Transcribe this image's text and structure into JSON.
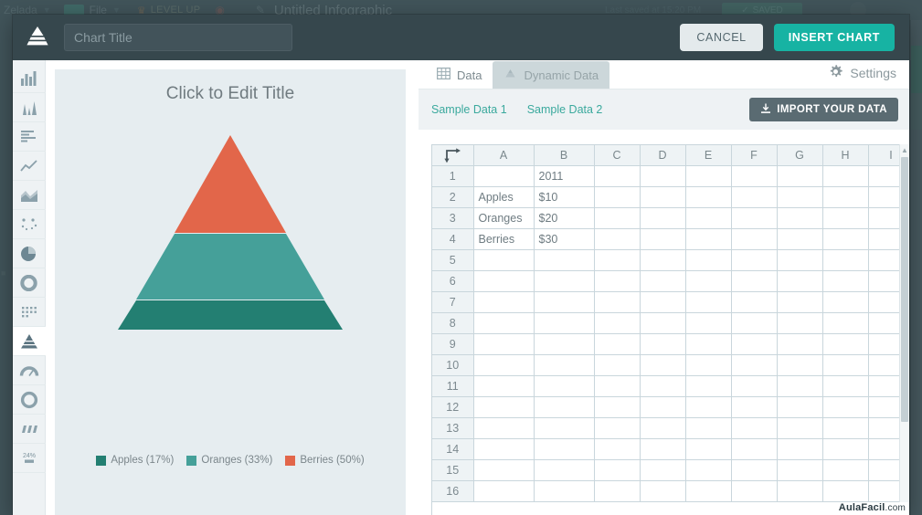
{
  "background": {
    "user": "Zelada",
    "file_menu": "File",
    "level_up": "LEVEL UP",
    "document_title": "Untitled Infographic",
    "last_saved": "Last saved at 15:20 PM",
    "saved_badge": "SAVED"
  },
  "header": {
    "logo": "pyramid-logo",
    "title_value": "",
    "title_placeholder": "Chart Title",
    "cancel_label": "CANCEL",
    "insert_label": "INSERT CHART"
  },
  "chart_types": [
    {
      "name": "bar-chart",
      "label": "Bar Chart",
      "active": false
    },
    {
      "name": "column-chart",
      "label": "Column Chart",
      "active": false
    },
    {
      "name": "horizontal-bar-chart",
      "label": "Horizontal Bar Chart",
      "active": false
    },
    {
      "name": "line-chart",
      "label": "Line Chart",
      "active": false
    },
    {
      "name": "area-chart",
      "label": "Area Chart",
      "active": false
    },
    {
      "name": "scatter-chart",
      "label": "Scatter Chart",
      "active": false
    },
    {
      "name": "pie-chart",
      "label": "Pie Chart",
      "active": false
    },
    {
      "name": "donut-chart",
      "label": "Donut Chart",
      "active": false
    },
    {
      "name": "matrix-chart",
      "label": "Matrix Chart",
      "active": false
    },
    {
      "name": "pyramid-chart",
      "label": "Pyramid Chart",
      "active": true
    },
    {
      "name": "gauge-chart",
      "label": "Gauge Chart",
      "active": false
    },
    {
      "name": "ring-chart",
      "label": "Ring Chart",
      "active": false
    },
    {
      "name": "tornado-chart",
      "label": "Tornado Chart",
      "active": false
    },
    {
      "name": "percent-chart",
      "label": "24%",
      "active": false
    }
  ],
  "preview": {
    "title": "Click to Edit Title"
  },
  "data_panel": {
    "tabs": [
      {
        "label": "Data",
        "icon": "grid-icon",
        "active": true
      },
      {
        "label": "Dynamic Data",
        "icon": "google-drive-icon",
        "active": false
      }
    ],
    "settings_label": "Settings",
    "sample_links": [
      "Sample Data 1",
      "Sample Data 2"
    ],
    "import_label": "IMPORT YOUR DATA"
  },
  "grid": {
    "corner_icon": "transpose-arrow-icon",
    "columns": [
      "A",
      "B",
      "C",
      "D",
      "E",
      "F",
      "G",
      "H",
      "I"
    ],
    "rows": [
      {
        "n": "1",
        "cells": [
          "",
          "2011",
          "",
          "",
          "",
          "",
          "",
          "",
          ""
        ]
      },
      {
        "n": "2",
        "cells": [
          "Apples",
          "$10",
          "",
          "",
          "",
          "",
          "",
          "",
          ""
        ]
      },
      {
        "n": "3",
        "cells": [
          "Oranges",
          "$20",
          "",
          "",
          "",
          "",
          "",
          "",
          ""
        ]
      },
      {
        "n": "4",
        "cells": [
          "Berries",
          "$30",
          "",
          "",
          "",
          "",
          "",
          "",
          ""
        ]
      },
      {
        "n": "5",
        "cells": [
          "",
          "",
          "",
          "",
          "",
          "",
          "",
          "",
          ""
        ]
      },
      {
        "n": "6",
        "cells": [
          "",
          "",
          "",
          "",
          "",
          "",
          "",
          "",
          ""
        ]
      },
      {
        "n": "7",
        "cells": [
          "",
          "",
          "",
          "",
          "",
          "",
          "",
          "",
          ""
        ]
      },
      {
        "n": "8",
        "cells": [
          "",
          "",
          "",
          "",
          "",
          "",
          "",
          "",
          ""
        ]
      },
      {
        "n": "9",
        "cells": [
          "",
          "",
          "",
          "",
          "",
          "",
          "",
          "",
          ""
        ]
      },
      {
        "n": "10",
        "cells": [
          "",
          "",
          "",
          "",
          "",
          "",
          "",
          "",
          ""
        ]
      },
      {
        "n": "11",
        "cells": [
          "",
          "",
          "",
          "",
          "",
          "",
          "",
          "",
          ""
        ]
      },
      {
        "n": "12",
        "cells": [
          "",
          "",
          "",
          "",
          "",
          "",
          "",
          "",
          ""
        ]
      },
      {
        "n": "13",
        "cells": [
          "",
          "",
          "",
          "",
          "",
          "",
          "",
          "",
          ""
        ]
      },
      {
        "n": "14",
        "cells": [
          "",
          "",
          "",
          "",
          "",
          "",
          "",
          "",
          ""
        ]
      },
      {
        "n": "15",
        "cells": [
          "",
          "",
          "",
          "",
          "",
          "",
          "",
          "",
          ""
        ]
      },
      {
        "n": "16",
        "cells": [
          "",
          "",
          "",
          "",
          "",
          "",
          "",
          "",
          ""
        ]
      }
    ]
  },
  "watermark": {
    "name": "AulaFacil",
    "tld": ".com"
  },
  "colors": {
    "accent": "#17b3a3",
    "apples": "#237f72",
    "oranges": "#45a099",
    "berries": "#e2664a",
    "preview_bg": "#e6edf0",
    "modal_header": "#36474d"
  },
  "chart_data": {
    "type": "pie",
    "title": "Click to Edit Title",
    "subtitle": "",
    "xlabel": "",
    "ylabel": "",
    "series_header": "2011",
    "categories": [
      "Apples",
      "Oranges",
      "Berries"
    ],
    "values": [
      10,
      20,
      30
    ],
    "value_labels": [
      "$10",
      "$20",
      "$30"
    ],
    "percents": [
      17,
      33,
      50
    ],
    "colors": [
      "#237f72",
      "#45a099",
      "#e2664a"
    ],
    "legend": [
      "Apples (17%)",
      "Oranges (33%)",
      "Berries (50%)"
    ],
    "legend_position": "bottom",
    "grid": false,
    "render": "pyramid"
  }
}
